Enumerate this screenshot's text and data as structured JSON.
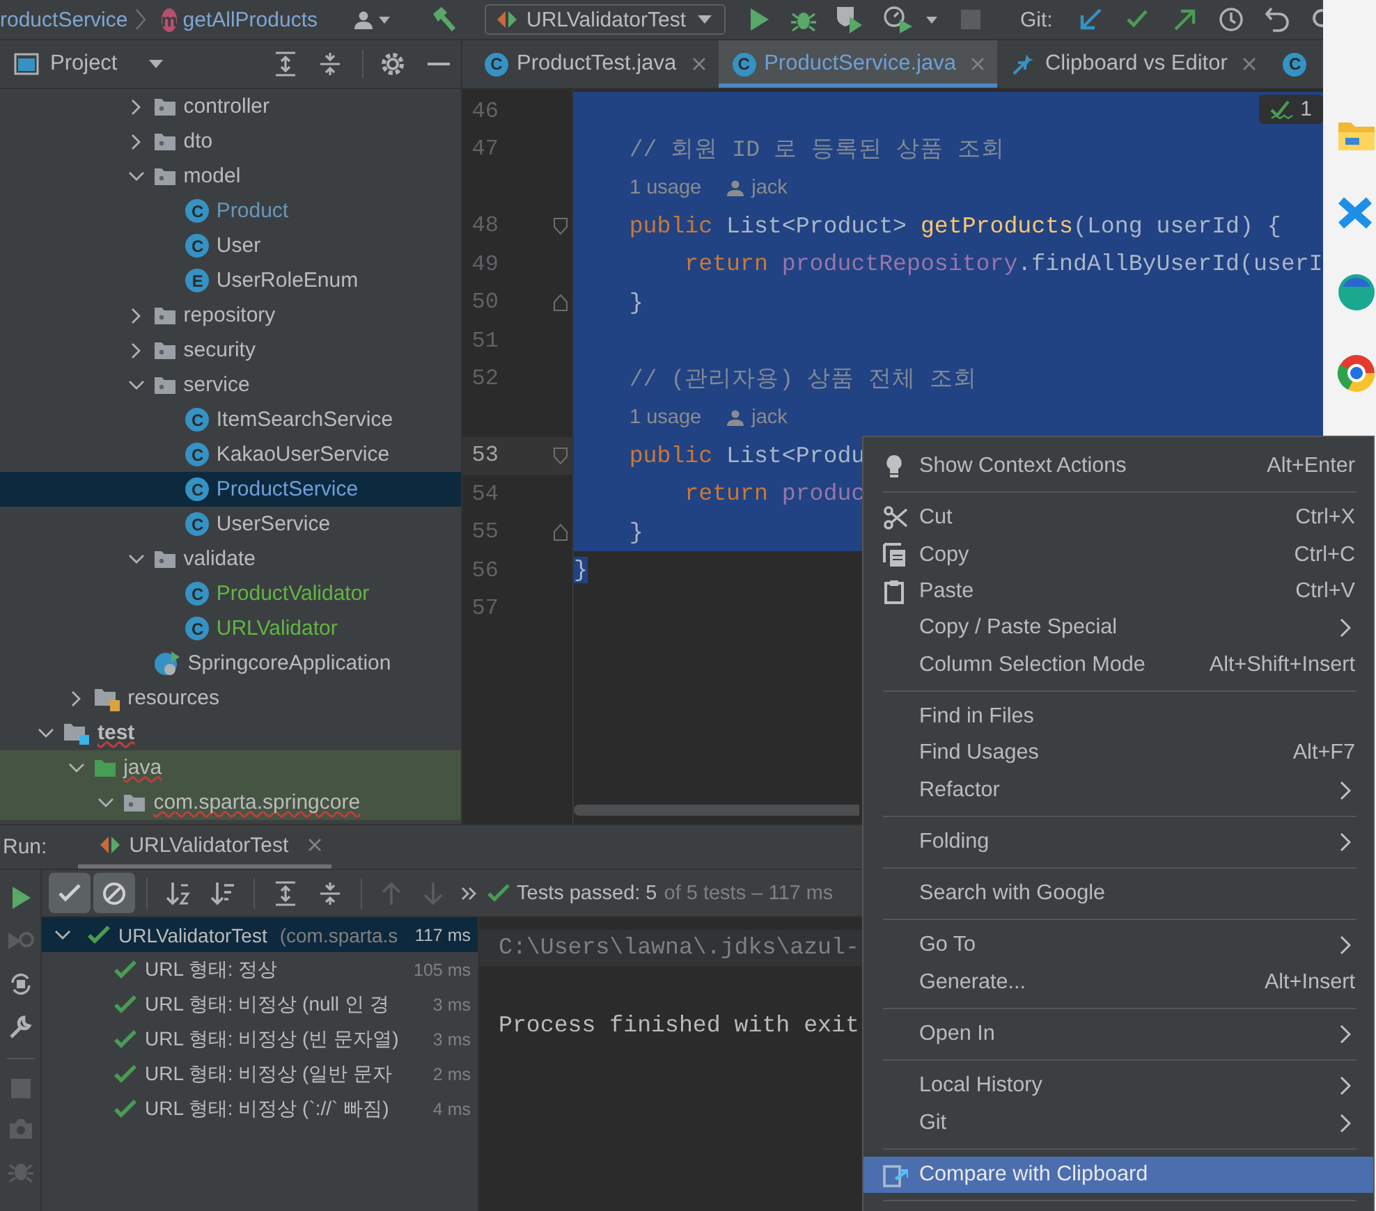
{
  "breadcrumbs": [
    {
      "label": "roductService",
      "kind": "plain"
    },
    {
      "label": "getAllProducts",
      "kind": "method",
      "icon_letter": "m"
    }
  ],
  "run_config": {
    "label": "URLValidatorTest"
  },
  "git_label": "Git:",
  "project_panel": {
    "title": "Project"
  },
  "editor_tabs": [
    {
      "label": "ProductTest.java",
      "kind": "file",
      "icon_letter": "C",
      "modified": false,
      "selected": false,
      "closable": true
    },
    {
      "label": "ProductService.java",
      "kind": "file",
      "icon_letter": "C",
      "modified": true,
      "selected": true,
      "closable": true
    },
    {
      "label": "Clipboard vs Editor",
      "kind": "diff",
      "modified": false,
      "selected": false,
      "closable": true
    },
    {
      "kind": "file",
      "icon_letter": "C",
      "selected": false
    }
  ],
  "inspection_badge": {
    "count": "1"
  },
  "tree": [
    {
      "children": [
        {
          "children": [
            {
              "children": [
                {
                  "label": "controller",
                  "kind": "package",
                  "expanded": false,
                  "selected": false
                },
                {
                  "label": "dto",
                  "kind": "package",
                  "expanded": false,
                  "selected": false
                },
                {
                  "label": "model",
                  "kind": "package",
                  "expanded": true,
                  "selected": false,
                  "children": [
                    {
                      "label": "Product",
                      "kind": "class",
                      "icon_letter": "C",
                      "color": "#6897bb",
                      "selected": false
                    },
                    {
                      "label": "User",
                      "kind": "class",
                      "icon_letter": "C",
                      "color": "#bbbbbb",
                      "selected": false
                    },
                    {
                      "label": "UserRoleEnum",
                      "kind": "class",
                      "icon_letter": "E",
                      "color": "#bbbbbb",
                      "selected": false
                    }
                  ]
                },
                {
                  "label": "repository",
                  "kind": "package",
                  "expanded": false,
                  "selected": false
                },
                {
                  "label": "security",
                  "kind": "package",
                  "expanded": false,
                  "selected": false
                },
                {
                  "label": "service",
                  "kind": "package",
                  "expanded": true,
                  "selected": false,
                  "children": [
                    {
                      "label": "ItemSearchService",
                      "kind": "class",
                      "icon_letter": "C",
                      "color": "#bbbbbb",
                      "selected": false
                    },
                    {
                      "label": "KakaoUserService",
                      "kind": "class",
                      "icon_letter": "C",
                      "color": "#bbbbbb",
                      "selected": false
                    },
                    {
                      "label": "ProductService",
                      "kind": "class",
                      "icon_letter": "C",
                      "color": "#6f9fd8",
                      "selected": true
                    },
                    {
                      "label": "UserService",
                      "kind": "class",
                      "icon_letter": "C",
                      "color": "#bbbbbb",
                      "selected": false
                    }
                  ]
                },
                {
                  "label": "validate",
                  "kind": "package",
                  "expanded": true,
                  "selected": false,
                  "children": [
                    {
                      "label": "ProductValidator",
                      "kind": "class",
                      "icon_letter": "C",
                      "color": "#62b543",
                      "selected": false
                    },
                    {
                      "label": "URLValidator",
                      "kind": "class",
                      "icon_letter": "C",
                      "color": "#62b543",
                      "selected": false
                    }
                  ]
                },
                {
                  "label": "SpringcoreApplication",
                  "kind": "app",
                  "color": "#bbbbbb",
                  "selected": false
                }
              ]
            }
          ]
        },
        {
          "label": "resources",
          "kind": "resources",
          "expanded": false,
          "selected": false
        }
      ]
    },
    {
      "label": "test",
      "kind": "test-root",
      "expanded": true,
      "error": true,
      "highlighted": false,
      "selected": false,
      "children": [
        {
          "label": "java",
          "kind": "source-root",
          "expanded": true,
          "error": true,
          "highlighted": true,
          "selected": false,
          "children": [
            {
              "label": "com.sparta.springcore",
              "kind": "package",
              "expanded": true,
              "error": true,
              "highlighted": true,
              "selected": false
            }
          ]
        }
      ]
    }
  ],
  "editor_lines": [
    {
      "kind": "code",
      "number": "46",
      "selected": true,
      "current": false
    },
    {
      "kind": "code",
      "number": "47",
      "selected": true,
      "current": false,
      "segments": [
        {
          "kind": "comment",
          "text": "    // 회원 ID 로 등록된 상품 조회"
        }
      ]
    },
    {
      "kind": "hint",
      "usages": "1 usage",
      "author": "jack",
      "selected": true
    },
    {
      "kind": "code",
      "number": "48",
      "selected": true,
      "current": false,
      "fold_start": true,
      "segments": [
        {
          "kind": "keyword",
          "text": "    public"
        },
        {
          "kind": "plain",
          "text": " List<Product> "
        },
        {
          "kind": "method",
          "text": "getProducts"
        },
        {
          "kind": "plain",
          "text": "(Long userId) {"
        }
      ]
    },
    {
      "kind": "code",
      "number": "49",
      "selected": true,
      "current": false,
      "segments": [
        {
          "kind": "keyword",
          "text": "        return "
        },
        {
          "kind": "field",
          "text": "productRepository"
        },
        {
          "kind": "plain",
          "text": ".findAllByUserId(userI"
        }
      ]
    },
    {
      "kind": "code",
      "number": "50",
      "selected": true,
      "current": false,
      "fold_end": true,
      "segments": [
        {
          "kind": "plain",
          "text": "    }"
        }
      ]
    },
    {
      "kind": "code",
      "number": "51",
      "selected": true,
      "current": false
    },
    {
      "kind": "code",
      "number": "52",
      "selected": true,
      "current": false,
      "segments": [
        {
          "kind": "comment",
          "text": "    // (관리자용) 상품 전체 조회"
        }
      ]
    },
    {
      "kind": "hint",
      "usages": "1 usage",
      "author": "jack",
      "selected": true
    },
    {
      "kind": "code",
      "number": "53",
      "selected": true,
      "current": true,
      "fold_start": true,
      "segments": [
        {
          "kind": "keyword",
          "text": "    public"
        },
        {
          "kind": "plain",
          "text": " List<Produ"
        }
      ]
    },
    {
      "kind": "code",
      "number": "54",
      "selected": true,
      "current": false,
      "segments": [
        {
          "kind": "keyword",
          "text": "        return "
        },
        {
          "kind": "field",
          "text": "produc"
        }
      ]
    },
    {
      "kind": "code",
      "number": "55",
      "selected": true,
      "current": false,
      "fold_end": true,
      "segments": [
        {
          "kind": "plain",
          "text": "    }"
        }
      ]
    },
    {
      "kind": "code",
      "number": "56",
      "selected": false,
      "current": false,
      "segments": [
        {
          "kind": "plain",
          "text": "}",
          "selected": true
        }
      ]
    },
    {
      "kind": "code",
      "number": "57",
      "selected": false,
      "current": false
    }
  ],
  "run_panel": {
    "title": "Run:",
    "tab": "URLValidatorTest",
    "filters": [
      {
        "kind": "passed",
        "on": true
      },
      {
        "kind": "ignored",
        "on": true
      }
    ],
    "status_main": "Tests passed: 5",
    "status_rest": "of 5 tests – 117 ms",
    "tests": {
      "label": "URLValidatorTest",
      "package": "(com.sparta.s",
      "duration": "117 ms",
      "passed": true,
      "expanded": true,
      "selected": true,
      "children": [
        {
          "label": "URL 형태: 정상",
          "duration": "105 ms",
          "passed": true,
          "selected": false
        },
        {
          "label": "URL 형태: 비정상 (null 인 경",
          "duration": "3 ms",
          "passed": true,
          "selected": false
        },
        {
          "label": "URL 형태: 비정상 (빈 문자열)",
          "duration": "3 ms",
          "passed": true,
          "selected": false
        },
        {
          "label": "URL 형태: 비정상 (일반 문자",
          "duration": "2 ms",
          "passed": true,
          "selected": false
        },
        {
          "label": "URL 형태: 비정상 (`://` 빠짐)",
          "duration": "4 ms",
          "passed": true,
          "selected": false
        }
      ]
    },
    "console": [
      {
        "kind": "command",
        "text": "C:\\Users\\lawna\\.jdks\\azul-"
      },
      {
        "kind": "output",
        "text": "Process finished with exit"
      }
    ]
  },
  "context_menu": [
    {
      "kind": "item",
      "label": "Show Context Actions",
      "shortcut": "Alt+Enter",
      "submenu": false,
      "selected": false
    },
    {
      "kind": "separator"
    },
    {
      "kind": "item",
      "label": "Cut",
      "shortcut": "Ctrl+X",
      "submenu": false,
      "selected": false
    },
    {
      "kind": "item",
      "label": "Copy",
      "shortcut": "Ctrl+C",
      "submenu": false,
      "selected": false
    },
    {
      "kind": "item",
      "label": "Paste",
      "shortcut": "Ctrl+V",
      "submenu": false,
      "selected": false
    },
    {
      "kind": "item",
      "label": "Copy / Paste Special",
      "submenu": true,
      "selected": false
    },
    {
      "kind": "item",
      "label": "Column Selection Mode",
      "shortcut": "Alt+Shift+Insert",
      "submenu": false,
      "selected": false
    },
    {
      "kind": "separator"
    },
    {
      "kind": "item",
      "label": "Find in Files",
      "submenu": false,
      "selected": false
    },
    {
      "kind": "item",
      "label": "Find Usages",
      "shortcut": "Alt+F7",
      "submenu": false,
      "selected": false
    },
    {
      "kind": "item",
      "label": "Refactor",
      "submenu": true,
      "selected": false
    },
    {
      "kind": "separator"
    },
    {
      "kind": "item",
      "label": "Folding",
      "submenu": true,
      "selected": false
    },
    {
      "kind": "separator"
    },
    {
      "kind": "item",
      "label": "Search with Google",
      "submenu": false,
      "selected": false
    },
    {
      "kind": "separator"
    },
    {
      "kind": "item",
      "label": "Go To",
      "submenu": true,
      "selected": false
    },
    {
      "kind": "item",
      "label": "Generate...",
      "shortcut": "Alt+Insert",
      "submenu": false,
      "selected": false
    },
    {
      "kind": "separator"
    },
    {
      "kind": "item",
      "label": "Open In",
      "submenu": true,
      "selected": false
    },
    {
      "kind": "separator"
    },
    {
      "kind": "item",
      "label": "Local History",
      "submenu": true,
      "selected": false
    },
    {
      "kind": "item",
      "label": "Git",
      "submenu": true,
      "selected": false
    },
    {
      "kind": "separator"
    },
    {
      "kind": "item",
      "label": "Compare with Clipboard",
      "submenu": false,
      "selected": true
    },
    {
      "kind": "separator"
    }
  ]
}
